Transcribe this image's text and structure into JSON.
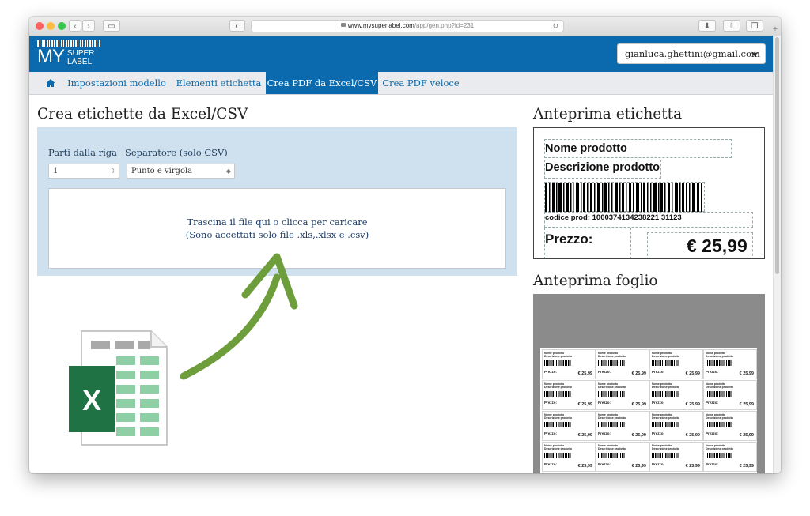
{
  "browser": {
    "url_domain": "www.mysuperlabel.com",
    "url_path": "/app/gen.php?id=231"
  },
  "header": {
    "logo": {
      "my": "MY",
      "super": "SUPER",
      "label": "LABEL"
    },
    "user_email": "gianluca.ghettini@gmail.com"
  },
  "nav": {
    "tabs": [
      {
        "label": "Impostazioni modello"
      },
      {
        "label": "Elementi etichetta"
      },
      {
        "label": "Crea PDF da Excel/CSV",
        "active": true
      },
      {
        "label": "Crea PDF veloce"
      }
    ]
  },
  "main": {
    "title": "Crea etichette da Excel/CSV",
    "start_row": {
      "label": "Parti dalla riga",
      "value": "1"
    },
    "separator": {
      "label": "Separatore (solo CSV)",
      "value": "Punto e virgola"
    },
    "dropzone": {
      "line1": "Trascina il file qui o clicca per caricare",
      "line2": "(Sono accettati solo file .xls,.xlsx e .csv)"
    }
  },
  "preview": {
    "label_title": "Anteprima etichetta",
    "sheet_title": "Anteprima foglio",
    "label": {
      "product_name": "Nome prodotto",
      "product_description": "Descrizione prodotto",
      "product_code": "codice prod: 1000374134238221 31123",
      "price_label": "Prezzo:",
      "price_value": "€ 25,99"
    },
    "mini": {
      "product_name": "Nome prodotto",
      "product_description": "Descrizione prodotto",
      "price_label": "Prezzo:",
      "price_value": "€ 25,99"
    }
  },
  "colors": {
    "brand_blue": "#0a6aad",
    "panel_bg": "#cfe0ee",
    "arrow_green": "#6e9e3c",
    "excel_green": "#1f7244"
  }
}
